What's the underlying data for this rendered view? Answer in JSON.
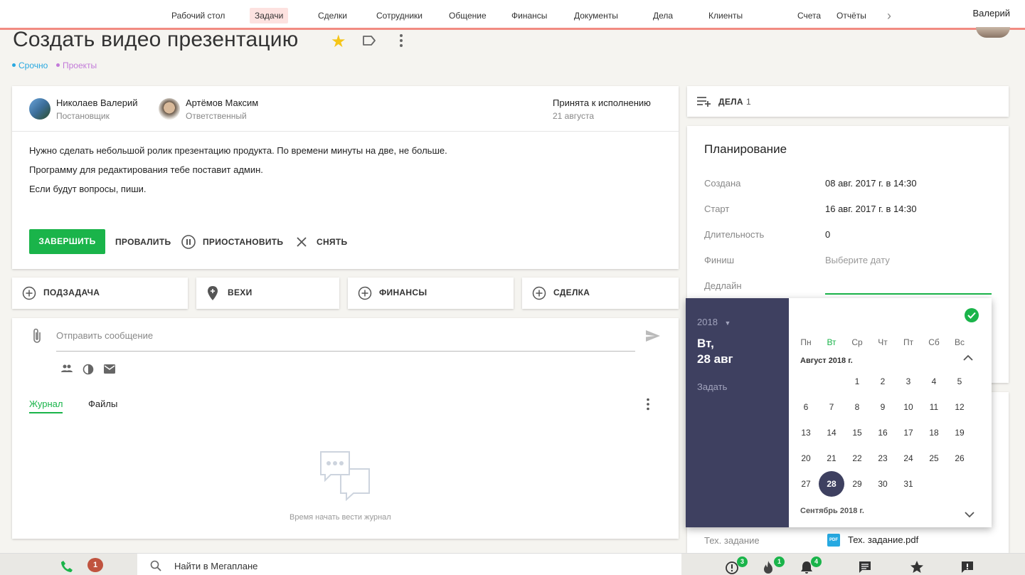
{
  "nav": {
    "items": [
      "Рабочий стол",
      "Задачи",
      "Сделки",
      "Сотрудники",
      "Общение",
      "Финансы",
      "Документы",
      "Дела",
      "Клиенты",
      "Счета",
      "Отчёты"
    ],
    "user": "Валерий"
  },
  "task": {
    "title": "Создать видео презентацию",
    "labels": [
      {
        "text": "Срочно",
        "color": "#29a8e0"
      },
      {
        "text": "Проекты",
        "color": "#c27ad9"
      }
    ]
  },
  "people": {
    "owner": {
      "name": "Николаев Валерий",
      "role": "Постановщик"
    },
    "assignee": {
      "name": "Артёмов Максим",
      "role": "Ответственный"
    },
    "status": "Принята к исполнению",
    "status_date": "21 августа"
  },
  "description": [
    "Нужно сделать небольшой ролик презентацию продукта. По времени минуты на две, не больше.",
    "Программу для редактирования тебе поставит админ.",
    "Если будут вопросы, пиши."
  ],
  "actions": {
    "complete": "ЗАВЕРШИТЬ",
    "fail": "ПРОВАЛИТЬ",
    "pause": "ПРИОСТАНОВИТЬ",
    "cancel": "СНЯТЬ"
  },
  "addons": {
    "subtask": "ПОДЗАДАЧА",
    "milestones": "ВЕХИ",
    "finance": "ФИНАНСЫ",
    "deal": "СДЕЛКА"
  },
  "messages": {
    "placeholder": "Отправить сообщение",
    "tabs": [
      "Журнал",
      "Файлы"
    ],
    "empty": "Время начать вести журнал"
  },
  "todos": {
    "label": "ДЕЛА",
    "count": "1"
  },
  "planning": {
    "title": "Планирование",
    "rows": [
      {
        "label": "Создана",
        "value": "08 авг. 2017 г. в 14:30"
      },
      {
        "label": "Старт",
        "value": "16 авг. 2017 г. в 14:30"
      },
      {
        "label": "Длительность",
        "value": "0"
      },
      {
        "label": "Финиш",
        "value": "Выберите дату"
      },
      {
        "label": "Дедлайн",
        "value": ""
      }
    ],
    "spec_label": "Тех. задание",
    "spec_file": "Тех. задание.pdf",
    "pdf_icon_text": "PDF"
  },
  "datepicker": {
    "year": "2018",
    "weekday_short": "Вт,",
    "date_short": "28 авг",
    "set_label": "Задать",
    "weekdays": [
      "Пн",
      "Вт",
      "Ср",
      "Чт",
      "Пт",
      "Сб",
      "Вс"
    ],
    "month_title": "Август 2018 г.",
    "next_month_title": "Сентябрь 2018 г.",
    "weeks": [
      [
        "",
        "",
        "1",
        "2",
        "3",
        "4",
        "5"
      ],
      [
        "6",
        "7",
        "8",
        "9",
        "10",
        "11",
        "12"
      ],
      [
        "13",
        "14",
        "15",
        "16",
        "17",
        "18",
        "19"
      ],
      [
        "20",
        "21",
        "22",
        "23",
        "24",
        "25",
        "26"
      ],
      [
        "27",
        "28",
        "29",
        "30",
        "31",
        "",
        ""
      ]
    ],
    "selected": "28",
    "accent": "#1ab44a",
    "panel_color": "#3e4060"
  },
  "bottombar": {
    "phone_badge": "1",
    "search_placeholder": "Найти в Мегаплане",
    "alerts_badge": "3",
    "fire_badge": "1",
    "bell_badge": "4"
  }
}
